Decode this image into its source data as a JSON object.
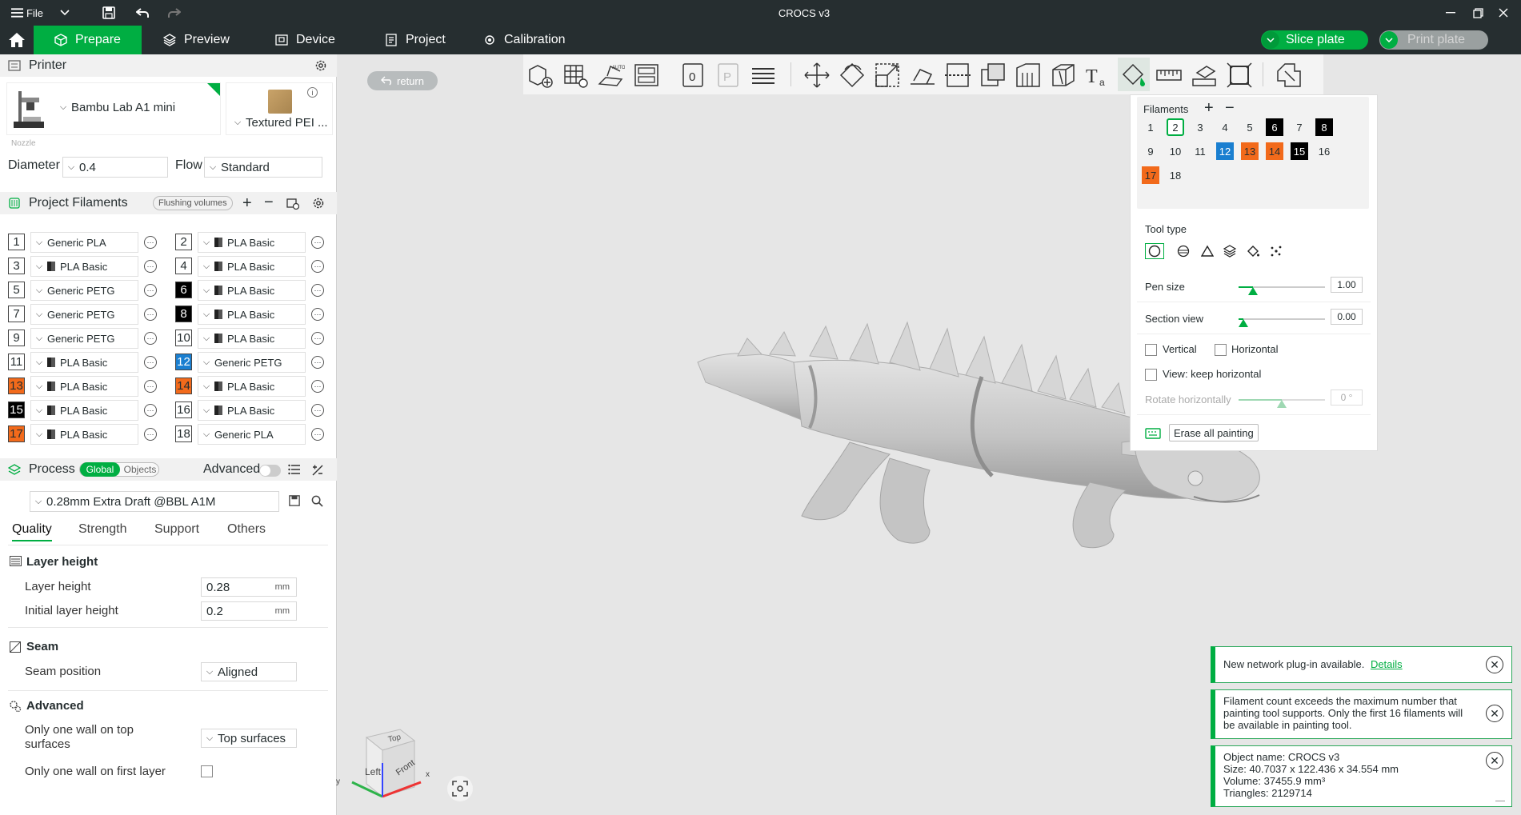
{
  "titlebar": {
    "menu_label": "File",
    "title": "CROCS v3"
  },
  "tabs": [
    {
      "label": "Prepare",
      "icon": "cube-icon"
    },
    {
      "label": "Preview",
      "icon": "layers-icon"
    },
    {
      "label": "Device",
      "icon": "device-icon"
    },
    {
      "label": "Project",
      "icon": "project-icon"
    },
    {
      "label": "Calibration",
      "icon": "calibration-icon"
    }
  ],
  "actions": {
    "slice_label": "Slice plate",
    "print_label": "Print plate"
  },
  "printer": {
    "section_title": "Printer",
    "model": "Bambu Lab A1 mini",
    "plate": "Textured PEI ...",
    "nozzle_caption": "Nozzle",
    "diameter_label": "Diameter",
    "diameter_value": "0.4",
    "flow_label": "Flow",
    "flow_value": "Standard"
  },
  "filaments_section": {
    "title": "Project Filaments",
    "flushing_label": "Flushing volumes",
    "items": [
      {
        "num": "1",
        "name": "Generic PLA",
        "color": "#ffffff",
        "text_color": "#262e30",
        "swatch": false
      },
      {
        "num": "2",
        "name": "PLA Basic",
        "color": "#ffffff",
        "text_color": "#262e30",
        "swatch": true
      },
      {
        "num": "3",
        "name": "PLA Basic",
        "color": "#ffffff",
        "text_color": "#262e30",
        "swatch": true
      },
      {
        "num": "4",
        "name": "PLA Basic",
        "color": "#ffffff",
        "text_color": "#262e30",
        "swatch": true
      },
      {
        "num": "5",
        "name": "Generic PETG",
        "color": "#ffffff",
        "text_color": "#262e30",
        "swatch": false
      },
      {
        "num": "6",
        "name": "PLA Basic",
        "color": "#000000",
        "text_color": "#ffffff",
        "swatch": true
      },
      {
        "num": "7",
        "name": "Generic PETG",
        "color": "#ffffff",
        "text_color": "#262e30",
        "swatch": false
      },
      {
        "num": "8",
        "name": "PLA Basic",
        "color": "#000000",
        "text_color": "#ffffff",
        "swatch": true
      },
      {
        "num": "9",
        "name": "Generic PETG",
        "color": "#ffffff",
        "text_color": "#262e30",
        "swatch": false
      },
      {
        "num": "10",
        "name": "PLA Basic",
        "color": "#ffffff",
        "text_color": "#262e30",
        "swatch": true
      },
      {
        "num": "11",
        "name": "PLA Basic",
        "color": "#ffffff",
        "text_color": "#262e30",
        "swatch": true
      },
      {
        "num": "12",
        "name": "Generic PETG",
        "color": "#1a7fd0",
        "text_color": "#ffffff",
        "swatch": false
      },
      {
        "num": "13",
        "name": "PLA Basic",
        "color": "#f26a1b",
        "text_color": "#262e30",
        "swatch": true
      },
      {
        "num": "14",
        "name": "PLA Basic",
        "color": "#f26a1b",
        "text_color": "#262e30",
        "swatch": true
      },
      {
        "num": "15",
        "name": "PLA Basic",
        "color": "#000000",
        "text_color": "#ffffff",
        "swatch": true
      },
      {
        "num": "16",
        "name": "PLA Basic",
        "color": "#ffffff",
        "text_color": "#262e30",
        "swatch": true
      },
      {
        "num": "17",
        "name": "PLA Basic",
        "color": "#f26a1b",
        "text_color": "#262e30",
        "swatch": true
      },
      {
        "num": "18",
        "name": "Generic PLA",
        "color": "#ffffff",
        "text_color": "#262e30",
        "swatch": false
      }
    ]
  },
  "process": {
    "title": "Process",
    "toggle_global": "Global",
    "toggle_objects": "Objects",
    "advanced_label": "Advanced",
    "preset": "0.28mm Extra Draft @BBL A1M",
    "subtabs": [
      "Quality",
      "Strength",
      "Support",
      "Others"
    ],
    "layer_height_group": "Layer height",
    "layer_height_label": "Layer height",
    "layer_height_value": "0.28",
    "initial_layer_label": "Initial layer height",
    "initial_layer_value": "0.2",
    "unit": "mm",
    "seam_group": "Seam",
    "seam_position_label": "Seam position",
    "seam_position_value": "Aligned",
    "advanced_group": "Advanced",
    "one_wall_top_label": "Only one wall on top surfaces",
    "one_wall_top_value": "Top surfaces",
    "one_wall_first_label": "Only one wall on first layer"
  },
  "viewport": {
    "return_label": "return",
    "cube_top": "Top",
    "cube_left": "Left",
    "cube_front": "Front",
    "axis_x": "x",
    "axis_y": "y"
  },
  "paint_panel": {
    "filaments_label": "Filaments",
    "filament_chips": [
      {
        "n": "1",
        "bg": "#ffffff",
        "fg": "#262e30"
      },
      {
        "n": "2",
        "bg": "#ffffff",
        "fg": "#262e30"
      },
      {
        "n": "3",
        "bg": "#ffffff",
        "fg": "#262e30"
      },
      {
        "n": "4",
        "bg": "#ffffff",
        "fg": "#262e30"
      },
      {
        "n": "5",
        "bg": "#ffffff",
        "fg": "#262e30"
      },
      {
        "n": "6",
        "bg": "#000000",
        "fg": "#ffffff"
      },
      {
        "n": "7",
        "bg": "#ffffff",
        "fg": "#262e30"
      },
      {
        "n": "8",
        "bg": "#000000",
        "fg": "#ffffff"
      },
      {
        "n": "9",
        "bg": "#ffffff",
        "fg": "#262e30"
      },
      {
        "n": "10",
        "bg": "#ffffff",
        "fg": "#262e30"
      },
      {
        "n": "11",
        "bg": "#ffffff",
        "fg": "#262e30"
      },
      {
        "n": "12",
        "bg": "#1a7fd0",
        "fg": "#ffffff"
      },
      {
        "n": "13",
        "bg": "#f26a1b",
        "fg": "#262e30"
      },
      {
        "n": "14",
        "bg": "#f26a1b",
        "fg": "#262e30"
      },
      {
        "n": "15",
        "bg": "#000000",
        "fg": "#ffffff"
      },
      {
        "n": "16",
        "bg": "#ffffff",
        "fg": "#262e30"
      },
      {
        "n": "17",
        "bg": "#f26a1b",
        "fg": "#262e30"
      },
      {
        "n": "18",
        "bg": "#ffffff",
        "fg": "#262e30"
      }
    ],
    "selected_filament": "2",
    "tool_type_label": "Tool type",
    "pen_size_label": "Pen size",
    "pen_size_value": "1.00",
    "section_view_label": "Section view",
    "section_view_value": "0.00",
    "vertical_label": "Vertical",
    "horizontal_label": "Horizontal",
    "keep_horizontal_label": "View: keep horizontal",
    "rotate_label": "Rotate horizontally",
    "rotate_value": "0 °",
    "erase_label": "Erase all painting"
  },
  "notifications": {
    "plugin_text": "New network plug-in available.",
    "plugin_link": "Details",
    "filament_warning": "Filament count exceeds the maximum number that painting tool supports. Only the first 16 filaments will be available in painting tool.",
    "object_name": "Object name: CROCS v3",
    "object_size": "Size: 40.7037 x 122.436 x 34.554 mm",
    "object_volume": "Volume: 37455.9 mm³",
    "object_triangles": "Triangles: 2129714"
  },
  "colors": {
    "accent": "#00ae42",
    "titlebar": "#262e30"
  }
}
